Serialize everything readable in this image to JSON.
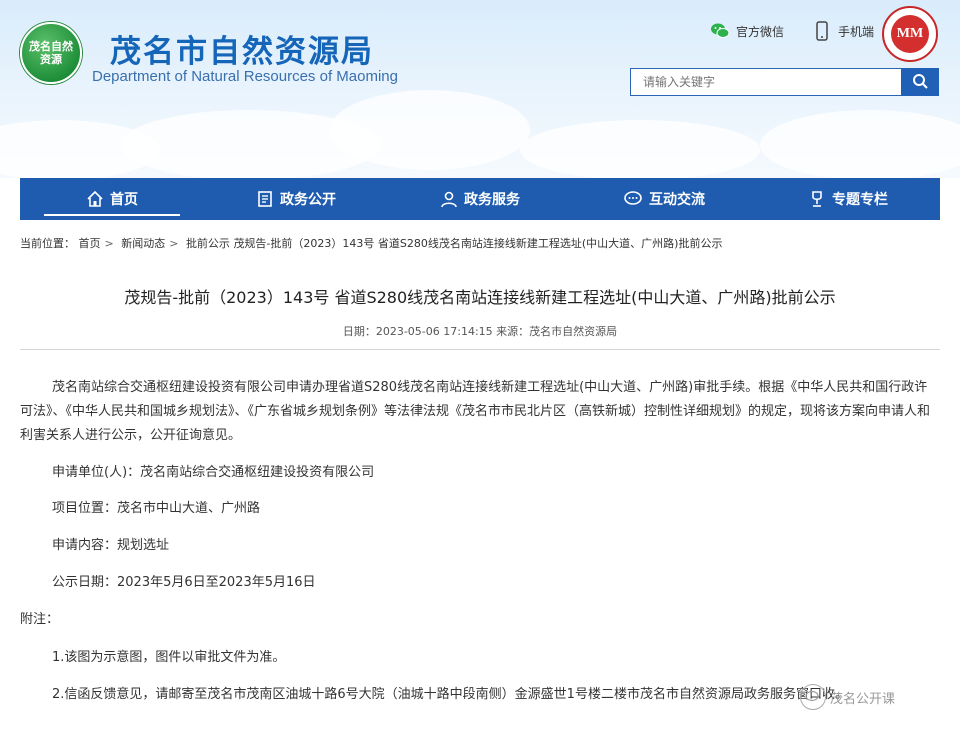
{
  "header": {
    "logo_text": "茂名自然资源",
    "title": "茂名市自然资源局",
    "subtitle": "Department of Natural Resources of Maoming",
    "links": [
      {
        "icon": "wechat-icon",
        "label": "官方微信"
      },
      {
        "icon": "mobile-icon",
        "label": "手机端"
      }
    ],
    "badge_text": "MM",
    "search": {
      "placeholder": "请输入关键字"
    }
  },
  "nav": {
    "items": [
      {
        "icon": "home-icon",
        "label": "首页",
        "active": true
      },
      {
        "icon": "document-icon",
        "label": "政务公开"
      },
      {
        "icon": "service-icon",
        "label": "政务服务"
      },
      {
        "icon": "chat-icon",
        "label": "互动交流"
      },
      {
        "icon": "trophy-icon",
        "label": "专题专栏"
      }
    ]
  },
  "breadcrumb": {
    "prefix": "当前位置：",
    "items": [
      "首页",
      "新闻动态",
      "批前公示",
      "茂规告-批前（2023）143号 省道S280线茂名南站连接线新建工程选址(中山大道、广州路)批前公示"
    ]
  },
  "article": {
    "title": "茂规告-批前（2023）143号 省道S280线茂名南站连接线新建工程选址(中山大道、广州路)批前公示",
    "meta": "日期：2023-05-06 17:14:15  来源：茂名市自然资源局",
    "intro": "茂名南站综合交通枢纽建设投资有限公司申请办理省道S280线茂名南站连接线新建工程选址(中山大道、广州路)审批手续。根据《中华人民共和国行政许可法》、《中华人民共和国城乡规划法》、《广东省城乡规划条例》等法律法规《茂名市市民北片区（高铁新城）控制性详细规划》的规定，现将该方案向申请人和利害关系人进行公示，公开征询意见。",
    "applicant": "申请单位(人)：茂名南站综合交通枢纽建设投资有限公司",
    "location": "项目位置：茂名市中山大道、广州路",
    "content": "申请内容：规划选址",
    "date": "公示日期：2023年5月6日至2023年5月16日",
    "notes_label": "附注：",
    "note1": "1.该图为示意图，图件以审批文件为准。",
    "note2": "2.信函反馈意见，请邮寄至茂名市茂南区油城十路6号大院（油城十路中段南侧）金源盛世1号楼二楼市茂名市自然资源局政务服务窗口收。"
  },
  "watermark": "茂名公开课"
}
